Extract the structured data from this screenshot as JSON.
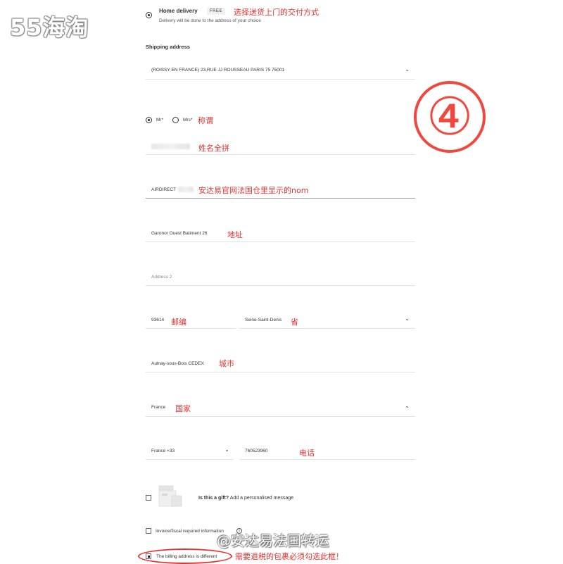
{
  "logo": {
    "text": "55海淘"
  },
  "delivery": {
    "title": "Home delivery",
    "badge": "FREE",
    "subtitle": "Delivery will be done to the address of your choice",
    "annotation": "选择送货上门的交付方式"
  },
  "shipping": {
    "heading": "Shipping address",
    "address_select": "(ROISSY EN FRANCE) 23,RUE JJ ROUSSEAU PARIS 75 75001"
  },
  "step_marker": "④",
  "title_field": {
    "options": [
      "Mr*",
      "Mrs*"
    ],
    "selected": "Mr*",
    "annotation": "称谓"
  },
  "name_field": {
    "annotation": "姓名全拼"
  },
  "lastname_field": {
    "value": "AIRDIRECT",
    "annotation": "安达易官网法国仓里显示的nom"
  },
  "address1_field": {
    "value": "Garonor Ouest Batiment 26",
    "annotation": "地址"
  },
  "address2_field": {
    "placeholder": "Address 2"
  },
  "postal_field": {
    "value": "93614",
    "annotation": "邮编"
  },
  "region_field": {
    "value": "Seine-Saint-Denis",
    "annotation": "省"
  },
  "city_field": {
    "value": "Aulnay-sous-Bois CEDEX",
    "annotation": "城市"
  },
  "country_field": {
    "value": "France",
    "annotation": "国家"
  },
  "phone": {
    "code": "France +33",
    "number": "760523960",
    "annotation": "电话"
  },
  "gift": {
    "label_bold": "Is this a gift?",
    "label_rest": " Add a personalised message"
  },
  "invoice": {
    "label": "Invoice/fiscal required information",
    "info_icon": "i"
  },
  "billing": {
    "label": "The billing address is different",
    "checked": true,
    "annotation": "需要退税的包裹必须勾选此框！"
  },
  "watermark": "@安达易法国转运",
  "colors": {
    "annotation": "#e8322f",
    "marker": "#f0473f"
  }
}
